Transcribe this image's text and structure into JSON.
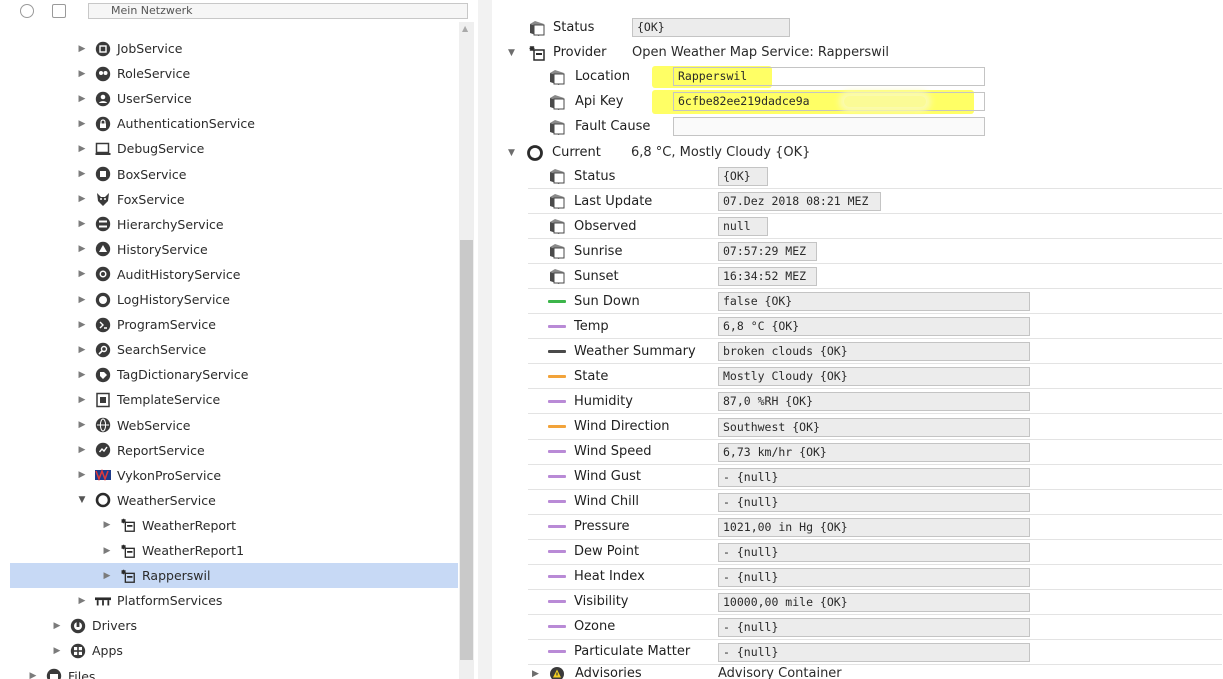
{
  "tree": {
    "root_label": "Mein Netzwerk",
    "items": [
      {
        "label": "JobService",
        "icon": "job-service-icon",
        "depth": 3,
        "arrow": "closed"
      },
      {
        "label": "RoleService",
        "icon": "role-service-icon",
        "depth": 3,
        "arrow": "closed"
      },
      {
        "label": "UserService",
        "icon": "user-service-icon",
        "depth": 3,
        "arrow": "closed"
      },
      {
        "label": "AuthenticationService",
        "icon": "lock-icon",
        "depth": 3,
        "arrow": "closed"
      },
      {
        "label": "DebugService",
        "icon": "debug-service-icon",
        "depth": 3,
        "arrow": "closed"
      },
      {
        "label": "BoxService",
        "icon": "box-service-icon",
        "depth": 3,
        "arrow": "closed"
      },
      {
        "label": "FoxService",
        "icon": "fox-icon",
        "depth": 3,
        "arrow": "closed"
      },
      {
        "label": "HierarchyService",
        "icon": "hierarchy-icon",
        "depth": 3,
        "arrow": "closed"
      },
      {
        "label": "HistoryService",
        "icon": "history-icon",
        "depth": 3,
        "arrow": "closed"
      },
      {
        "label": "AuditHistoryService",
        "icon": "audit-history-icon",
        "depth": 3,
        "arrow": "closed"
      },
      {
        "label": "LogHistoryService",
        "icon": "log-history-icon",
        "depth": 3,
        "arrow": "closed"
      },
      {
        "label": "ProgramService",
        "icon": "program-service-icon",
        "depth": 3,
        "arrow": "closed"
      },
      {
        "label": "SearchService",
        "icon": "search-icon",
        "depth": 3,
        "arrow": "closed"
      },
      {
        "label": "TagDictionaryService",
        "icon": "tag-dictionary-icon",
        "depth": 3,
        "arrow": "closed"
      },
      {
        "label": "TemplateService",
        "icon": "template-icon",
        "depth": 3,
        "arrow": "closed"
      },
      {
        "label": "WebService",
        "icon": "globe-icon",
        "depth": 3,
        "arrow": "closed"
      },
      {
        "label": "ReportService",
        "icon": "report-icon",
        "depth": 3,
        "arrow": "closed"
      },
      {
        "label": "VykonProService",
        "icon": "vykon-logo-icon",
        "depth": 3,
        "arrow": "closed"
      },
      {
        "label": "WeatherService",
        "icon": "weather-service-icon",
        "depth": 3,
        "arrow": "open"
      },
      {
        "label": "WeatherReport",
        "icon": "weather-report-icon",
        "depth": 4,
        "arrow": "closed"
      },
      {
        "label": "WeatherReport1",
        "icon": "weather-report-icon",
        "depth": 4,
        "arrow": "closed"
      },
      {
        "label": "Rapperswil",
        "icon": "weather-report-icon",
        "depth": 4,
        "arrow": "closed",
        "selected": true
      },
      {
        "label": "PlatformServices",
        "icon": "platform-services-icon",
        "depth": 3,
        "arrow": "closed"
      },
      {
        "label": "Drivers",
        "icon": "drivers-icon",
        "depth": 2,
        "arrow": "closed"
      },
      {
        "label": "Apps",
        "icon": "apps-icon",
        "depth": 2,
        "arrow": "closed"
      },
      {
        "label": "Files",
        "icon": "files-icon",
        "depth": 1,
        "arrow": "closed"
      }
    ]
  },
  "props": {
    "top_status": {
      "label": "Status",
      "value": "{OK}"
    },
    "provider": {
      "label": "Provider",
      "value": "Open Weather Map Service: Rapperswil"
    },
    "location": {
      "label": "Location",
      "value": "Rapperswil"
    },
    "api_key": {
      "label": "Api Key",
      "value": "6cfbe82ee219dadce9a"
    },
    "fault_cause": {
      "label": "Fault Cause",
      "value": ""
    },
    "current": {
      "label": "Current",
      "value": "6,8 °C, Mostly Cloudy {OK}"
    },
    "current_rows": [
      {
        "label": "Status",
        "value": "{OK}",
        "kind": "slot"
      },
      {
        "label": "Last Update",
        "value": "07.Dez 2018 08:21 MEZ",
        "kind": "slot"
      },
      {
        "label": "Observed",
        "value": "null",
        "kind": "slot"
      },
      {
        "label": "Sunrise",
        "value": "07:57:29 MEZ",
        "kind": "slot"
      },
      {
        "label": "Sunset",
        "value": "16:34:52 MEZ",
        "kind": "slot"
      },
      {
        "label": "Sun Down",
        "value": "false {OK}",
        "kind": "point",
        "color": "#3cb54a"
      },
      {
        "label": "Temp",
        "value": "6,8 °C {OK}",
        "kind": "point",
        "color": "#b98ad6"
      },
      {
        "label": "Weather Summary",
        "value": "broken clouds {OK}",
        "kind": "point",
        "color": "#4a4a4a"
      },
      {
        "label": "State",
        "value": "Mostly Cloudy {OK}",
        "kind": "point",
        "color": "#f2a33a"
      },
      {
        "label": "Humidity",
        "value": "87,0 %RH {OK}",
        "kind": "point",
        "color": "#b98ad6"
      },
      {
        "label": "Wind Direction",
        "value": "Southwest {OK}",
        "kind": "point",
        "color": "#f2a33a"
      },
      {
        "label": "Wind Speed",
        "value": "6,73 km/hr {OK}",
        "kind": "point",
        "color": "#b98ad6"
      },
      {
        "label": "Wind Gust",
        "value": "- {null}",
        "kind": "point",
        "color": "#b98ad6"
      },
      {
        "label": "Wind Chill",
        "value": "- {null}",
        "kind": "point",
        "color": "#b98ad6"
      },
      {
        "label": "Pressure",
        "value": "1021,00 in Hg {OK}",
        "kind": "point",
        "color": "#b98ad6"
      },
      {
        "label": "Dew Point",
        "value": "- {null}",
        "kind": "point",
        "color": "#b98ad6"
      },
      {
        "label": "Heat Index",
        "value": "- {null}",
        "kind": "point",
        "color": "#b98ad6"
      },
      {
        "label": "Visibility",
        "value": "10000,00 mile {OK}",
        "kind": "point",
        "color": "#b98ad6"
      },
      {
        "label": "Ozone",
        "value": "- {null}",
        "kind": "point",
        "color": "#b98ad6"
      },
      {
        "label": "Particulate Matter",
        "value": "- {null}",
        "kind": "point",
        "color": "#b98ad6"
      }
    ],
    "advisories": {
      "label": "Advisories",
      "value": "Advisory Container"
    }
  },
  "colors": {
    "selection": "#c7d9f5",
    "highlight": "#ffff3a",
    "sun_down_swatch": "#3cb54a",
    "numeric_swatch": "#b98ad6",
    "string_swatch": "#f2a33a"
  }
}
